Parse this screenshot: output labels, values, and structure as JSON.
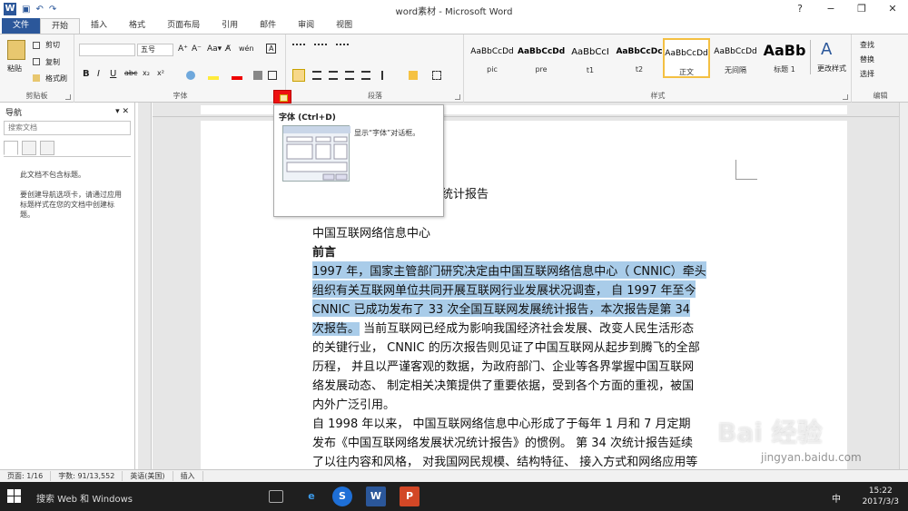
{
  "window": {
    "title": "word素材 - Microsoft Word",
    "controls": [
      "?",
      "−",
      "❐",
      "✕"
    ]
  },
  "qat": {
    "undo": "↶",
    "redo": "↷",
    "save": "▣"
  },
  "tabs": [
    "文件",
    "开始",
    "插入",
    "格式",
    "页面布局",
    "引用",
    "邮件",
    "审阅",
    "视图"
  ],
  "ribbon": {
    "clipboard": {
      "paste": "粘贴",
      "cut": "剪切",
      "copy": "复制",
      "format_painter": "格式刷",
      "label": "剪贴板"
    },
    "font": {
      "font_name": "",
      "font_size": "五号",
      "grow": "A⁺",
      "shrink": "A⁻",
      "case": "Aa▾",
      "clear": "A̸",
      "phonetic": "wén",
      "enclose": "A",
      "bold": "B",
      "italic": "I",
      "underline": "U",
      "strike": "abc",
      "sub": "x₂",
      "sup": "x²",
      "label": "字体"
    },
    "paragraph": {
      "label": "段落"
    },
    "styles": {
      "items": [
        {
          "sample": "AaBbCcDd",
          "name": "pic"
        },
        {
          "sample": "AaBbCcDd",
          "name": "pre"
        },
        {
          "sample": "AaBbCcI",
          "name": "t1"
        },
        {
          "sample": "AaBbCcDc",
          "name": "t2"
        },
        {
          "sample": "AaBbCcDd",
          "name": "正文"
        },
        {
          "sample": "AaBbCcDd",
          "name": "无间隔"
        },
        {
          "sample": "AaBb",
          "name": "标题 1"
        }
      ],
      "change_styles": "更改样式",
      "label": "样式"
    },
    "editing": {
      "find": "查找",
      "replace": "替换",
      "select": "选择",
      "label": "编辑"
    }
  },
  "tooltip": {
    "title": "字体 (Ctrl+D)",
    "description": "显示“字体”对话框。"
  },
  "nav": {
    "title": "导航",
    "search_placeholder": "搜索文档",
    "message1": "此文档不包含标题。",
    "message2": "要创建导航选项卡，请通过应用标题样式在您的文档中创建标题。"
  },
  "document": {
    "title_fragment": "统计报告",
    "lines": [
      "中国互联网络信息中心",
      "前言",
      "1997 年，国家主管部门研究决定由中国互联网络信息中心（ CNNIC）牵头",
      "组织有关互联网单位共同开展互联网行业发展状况调查， 自 1997 年至今",
      "CNNIC 已成功发布了 33 次全国互联网发展统计报告，本次报告是第 34",
      "次报告。",
      "当前互联网已经成为影响我国经济社会发展、改变人民生活形态",
      "的关键行业， CNNIC 的历次报告则见证了中国互联网从起步到腾飞的全部",
      "历程， 并且以严谨客观的数据，为政府部门、企业等各界掌握中国互联网",
      "络发展动态、 制定相关决策提供了重要依据，受到各个方面的重视，被国",
      "内外广泛引用。",
      "自 1998 年以来， 中国互联网络信息中心形成了于每年 1 月和 7 月定期",
      "发布《中国互联网络发展状况统计报告》的惯例。 第 34 次统计报告延续",
      "了以往内容和风格， 对我国网民规模、结构特征、 接入方式和网络应用等"
    ]
  },
  "status": {
    "page": "页面: 1/16",
    "words": "字数: 91/13,552",
    "lang": "英语(美国)",
    "mode": "插入"
  },
  "taskbar": {
    "search": "搜索 Web 和 Windows",
    "time": "15:22",
    "date": "2017/3/3",
    "ime": "中"
  },
  "watermark": {
    "main": "Bai 经验",
    "sub": "jingyan.baidu.com"
  },
  "colors": {
    "accent": "#2b579a",
    "highlight": "#a9cce9",
    "taskbar": "#1f1f1f"
  }
}
